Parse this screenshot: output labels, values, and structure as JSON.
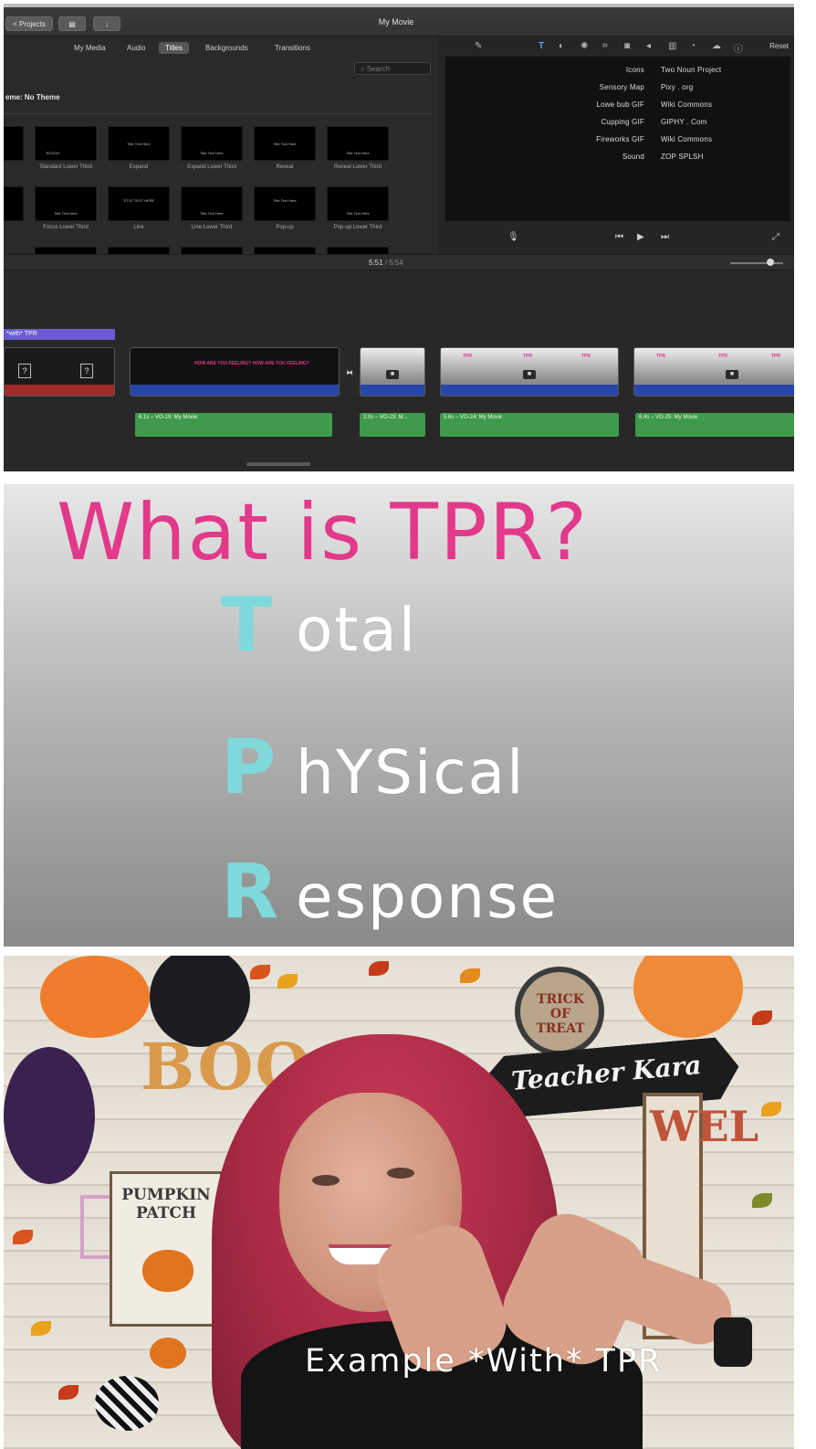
{
  "imovie": {
    "back_button": "< Projects",
    "window_title": "My Movie",
    "browser_tabs": [
      "My Media",
      "Audio",
      "Titles",
      "Backgrounds",
      "Transitions"
    ],
    "active_tab": "Titles",
    "search_placeholder": "Search",
    "theme_label": "eme: No Theme",
    "title_rows": [
      [
        {
          "caption": "",
          "inner": ""
        },
        {
          "caption": "Standard Lower Third",
          "inner": "ROUGH"
        },
        {
          "caption": "Expand",
          "inner": "Title Text Here"
        },
        {
          "caption": "Expand Lower Third",
          "inner": "Title Text Here"
        },
        {
          "caption": "Reveal",
          "inner": "Title Text Here"
        },
        {
          "caption": "Reveal Lower Third",
          "inner": "Title Text Here"
        }
      ],
      [
        {
          "caption": "",
          "inner": ""
        },
        {
          "caption": "Focus Lower Third",
          "inner": "Title Text Here"
        },
        {
          "caption": "Line",
          "inner": "TITLE TEXT HERE"
        },
        {
          "caption": "Line Lower Third",
          "inner": "Title Text Here"
        },
        {
          "caption": "Pop-up",
          "inner": "Title Text Here"
        },
        {
          "caption": "Pop-up Lower Third",
          "inner": "Title Text Here"
        }
      ]
    ],
    "inspector_reset": "Reset",
    "credits": [
      {
        "label": "Icons",
        "value": "Two Noun Project"
      },
      {
        "label": "Sensory Map",
        "value": "Pixy . org"
      },
      {
        "label": "Lowe bub GIF",
        "value": "Wiki Commons"
      },
      {
        "label": "Cupping GIF",
        "value": "GIPHY . Com"
      },
      {
        "label": "Fireworks GIF",
        "value": "Wiki Commons"
      },
      {
        "label": "Sound",
        "value": "ZOP SPLSH"
      }
    ],
    "time_current": "5:51",
    "time_separator": " / ",
    "time_total": "5:54",
    "title_clip_label": "*with* TPR",
    "audio_clips": [
      {
        "label": "6.1s – VO-19: My Movie"
      },
      {
        "label": "2.0s – VO-23: M..."
      },
      {
        "label": "5.6s – VO-24: My Movie"
      },
      {
        "label": "6.4s – VO-25: My Movie"
      }
    ],
    "clip_pink_text": "TPR",
    "clip_black_text": "HOW ARE YOU FEELING? HOW ARE YOU FEELING?"
  },
  "tpr_slide": {
    "title": "What is TPR?",
    "rows": [
      {
        "cap": "T",
        "rest": "otal"
      },
      {
        "cap": "P",
        "rest": "hYSical"
      },
      {
        "cap": "R",
        "rest": "esponse"
      }
    ]
  },
  "video_frame": {
    "sign_arrow": "Teacher Kara",
    "boo": "BOO",
    "trick_or_treat": "TRICK OF TREAT",
    "welcome": "WEL",
    "pumpkin_patch": "PUMPKIN PATCH",
    "caption": "Example *With* TPR"
  },
  "colors": {
    "tpr_title": "#e2398a",
    "tpr_letters": "#7fd9da",
    "timeline_blue": "#2747a8",
    "timeline_green": "#3f9a4b",
    "title_clip": "#6a5bd4"
  }
}
